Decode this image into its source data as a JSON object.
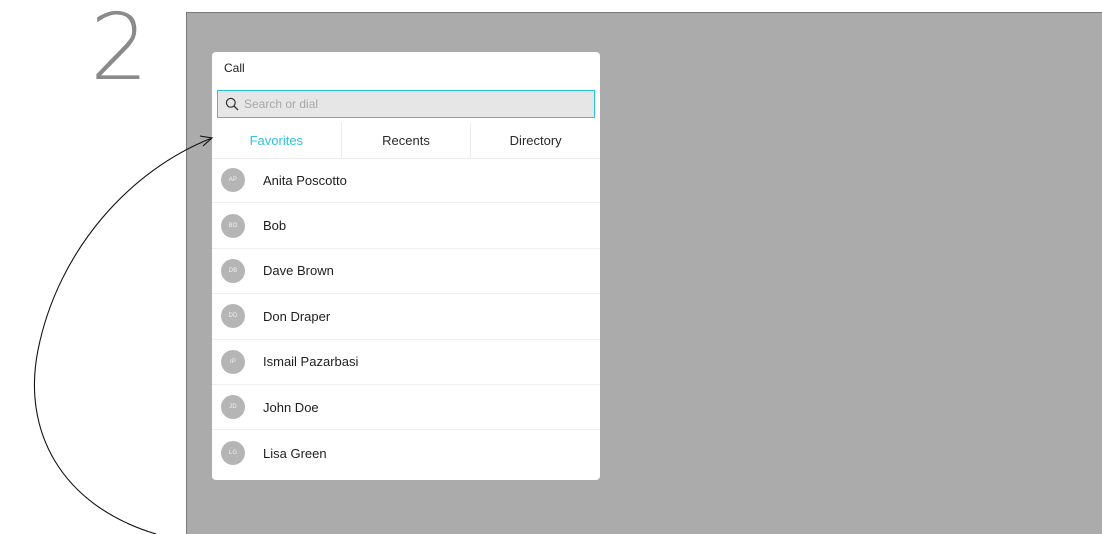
{
  "step": {
    "number": "2"
  },
  "panel": {
    "title": "Call",
    "search": {
      "placeholder": "Search or dial",
      "icon": "search-icon"
    },
    "tabs": [
      {
        "label": "Favorites",
        "active": true
      },
      {
        "label": "Recents",
        "active": false
      },
      {
        "label": "Directory",
        "active": false
      }
    ],
    "contacts": [
      {
        "initials": "AP",
        "name": "Anita Poscotto"
      },
      {
        "initials": "BO",
        "name": "Bob"
      },
      {
        "initials": "DB",
        "name": "Dave Brown"
      },
      {
        "initials": "DD",
        "name": "Don Draper"
      },
      {
        "initials": "IP",
        "name": "Ismail Pazarbasi"
      },
      {
        "initials": "JD",
        "name": "John Doe"
      },
      {
        "initials": "LG",
        "name": "Lisa Green"
      }
    ]
  },
  "colors": {
    "accent": "#2fc2e4",
    "screen_background": "#ababab",
    "avatar": "#b5b5b5"
  }
}
